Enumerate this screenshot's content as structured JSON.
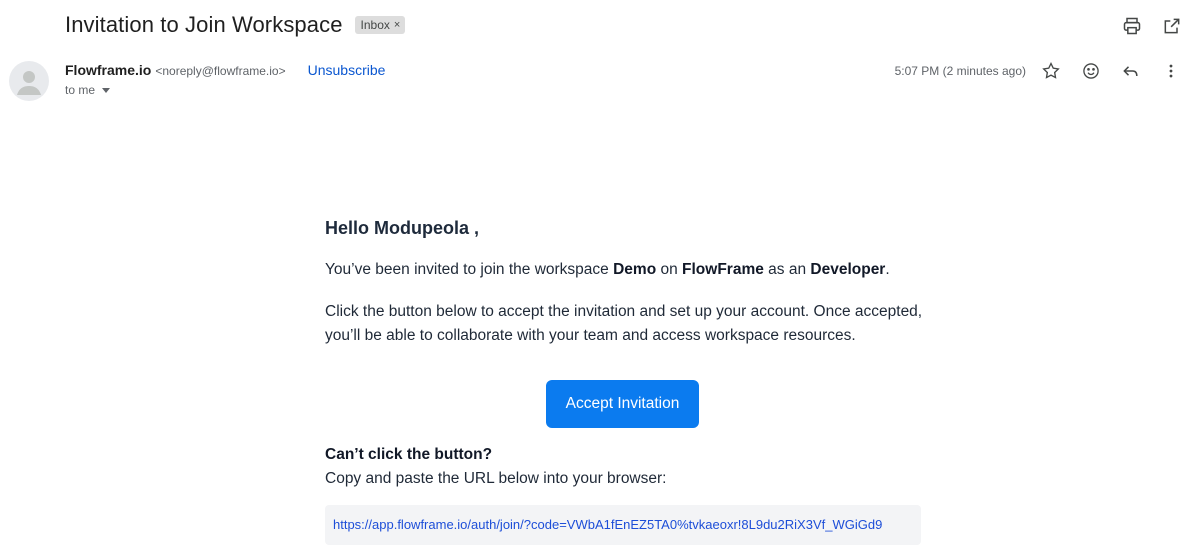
{
  "email": {
    "subject": "Invitation to Join Workspace",
    "label": "Inbox",
    "label_remove": "×"
  },
  "toolbar": {
    "icons": [
      "print-icon",
      "open-in-new-window-icon"
    ]
  },
  "sender": {
    "name": "Flowframe.io",
    "email": "<noreply@flowframe.io>",
    "unsubscribe": "Unsubscribe",
    "to": "to me"
  },
  "meta": {
    "time": "5:07 PM (2 minutes ago)",
    "icons": [
      "star-icon",
      "emoji-icon",
      "reply-icon",
      "more-vert-icon"
    ]
  },
  "body": {
    "greeting": "Hello Modupeola ,",
    "p1_prefix": "You’ve been invited to join the workspace ",
    "workspace": "Demo",
    "p1_on": " on ",
    "app": "FlowFrame",
    "p1_as": " as an ",
    "role": "Developer",
    "p1_suffix": ".",
    "p2": "Click the button below to accept the invitation and set up your account. Once accepted, you’ll be able to collaborate with your team and access workspace resources.",
    "cta": "Accept Invitation",
    "cant_click": "Can’t click the button?",
    "copy_paste": "Copy and paste the URL below into your browser:",
    "url": "https://app.flowframe.io/auth/join/?code=VWbA1fEnEZ5TA0%tvkaeoxr!8L9du2RiX3Vf_WGiGd9"
  },
  "colors": {
    "accent": "#0b7bef",
    "link": "#0b57d0",
    "chip_bg": "#dddddd"
  }
}
